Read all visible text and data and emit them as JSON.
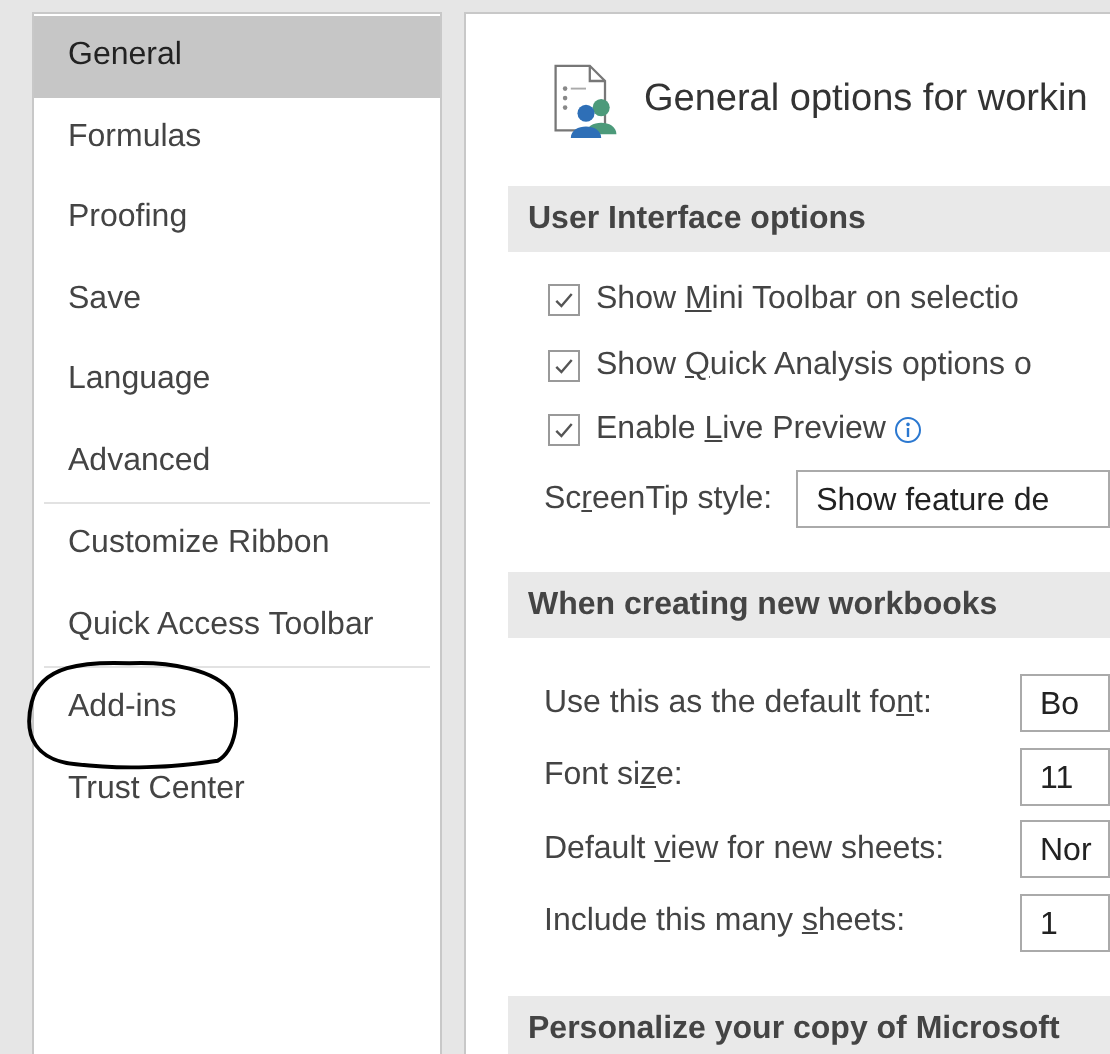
{
  "sidebar": {
    "groups": [
      {
        "items": [
          {
            "label": "General",
            "selected": true
          },
          {
            "label": "Formulas",
            "selected": false
          },
          {
            "label": "Proofing",
            "selected": false
          },
          {
            "label": "Save",
            "selected": false
          },
          {
            "label": "Language",
            "selected": false
          },
          {
            "label": "Advanced",
            "selected": false
          }
        ]
      },
      {
        "items": [
          {
            "label": "Customize Ribbon",
            "selected": false
          },
          {
            "label": "Quick Access Toolbar",
            "selected": false
          }
        ]
      },
      {
        "items": [
          {
            "label": "Add-ins",
            "selected": false
          },
          {
            "label": "Trust Center",
            "selected": false
          }
        ]
      }
    ]
  },
  "page_title": "General options for workin",
  "sections": [
    {
      "title": "User Interface options",
      "rows": [
        {
          "kind": "checkbox",
          "before": "Show ",
          "key": "M",
          "after": "ini Toolbar on selectio",
          "checked": true
        },
        {
          "kind": "checkbox",
          "before": "Show ",
          "key": "Q",
          "after": "uick Analysis options o",
          "checked": true
        },
        {
          "kind": "checkbox",
          "before": "Enable ",
          "key": "L",
          "after": "ive Preview",
          "checked": true,
          "info": true
        },
        {
          "kind": "dropdown",
          "before": "Sc",
          "key": "r",
          "after": "eenTip style:",
          "value": "Show feature de"
        }
      ]
    },
    {
      "title": "When creating new workbooks",
      "rows": [
        {
          "kind": "field",
          "before": "Use this as the default fo",
          "key": "n",
          "after": "t:",
          "value": "Bo"
        },
        {
          "kind": "field",
          "before": "Font si",
          "key": "z",
          "after": "e:",
          "value": "11"
        },
        {
          "kind": "field",
          "before": "Default ",
          "key": "v",
          "after": "iew for new sheets:",
          "value": "Nor"
        },
        {
          "kind": "field",
          "before": "Include this many ",
          "key": "s",
          "after": "heets:",
          "value": "1"
        }
      ]
    },
    {
      "title": "Personalize your copy of Microsoft"
    }
  ],
  "annotation": {
    "kind": "circle"
  }
}
